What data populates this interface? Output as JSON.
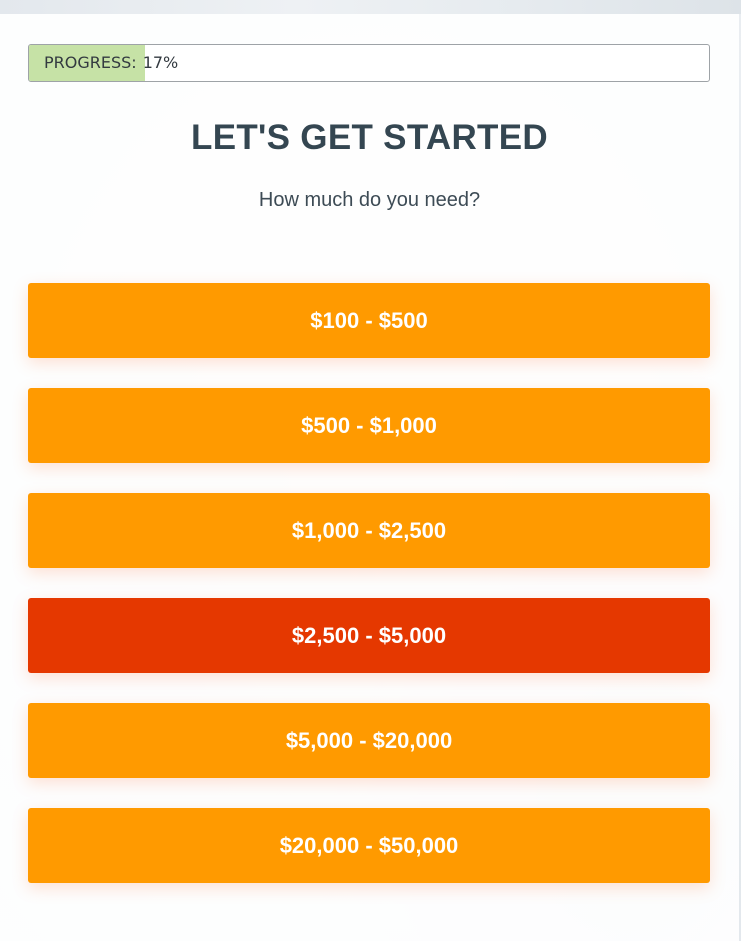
{
  "progress": {
    "label": "PROGRESS:",
    "value_text": "17%",
    "percent": 17
  },
  "heading": {
    "title": "LET'S GET STARTED",
    "question": "How much do you need?"
  },
  "options": [
    {
      "label": "$100 - $500"
    },
    {
      "label": "$500 - $1,000"
    },
    {
      "label": "$1,000 - $2,500"
    },
    {
      "label": "$2,500 - $5,000",
      "selected": true
    },
    {
      "label": "$5,000 - $20,000"
    },
    {
      "label": "$20,000 - $50,000"
    }
  ],
  "colors": {
    "option": "#ff9a00",
    "option_selected": "#e53800",
    "progress_fill": "#c6e2a6",
    "heading": "#344651"
  }
}
